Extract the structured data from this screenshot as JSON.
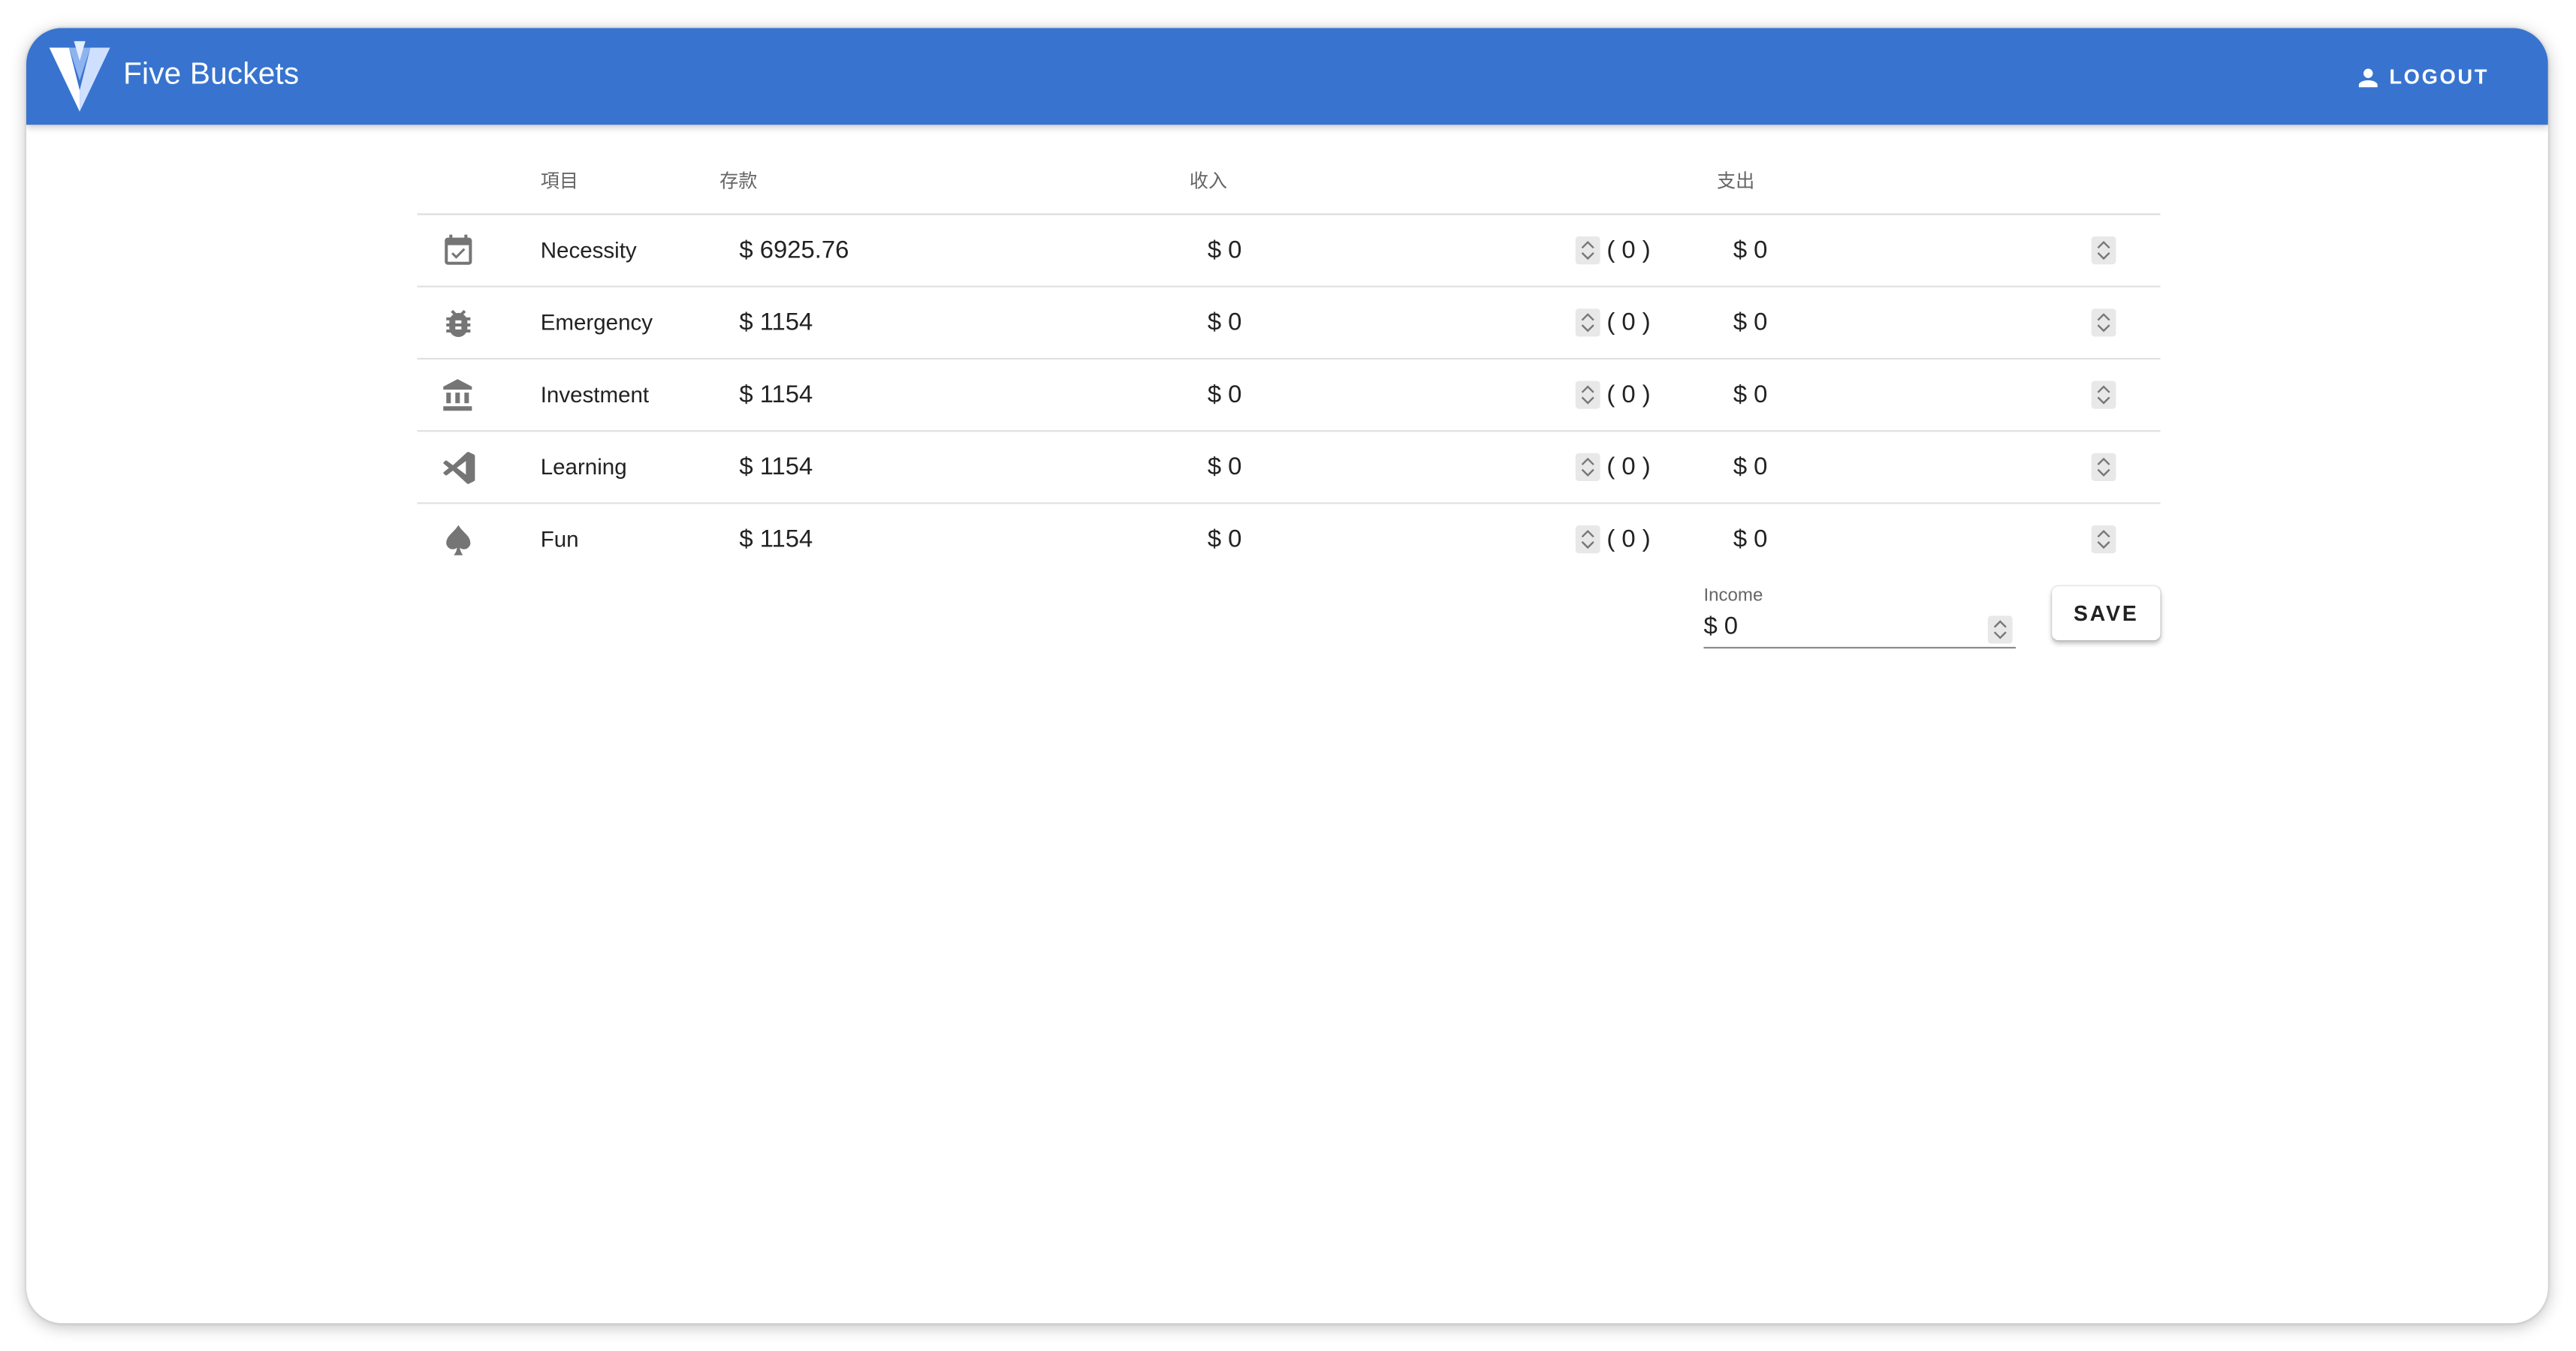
{
  "app": {
    "title": "Five Buckets",
    "logout_label": "LOGOUT",
    "brand_color": "#3874CF"
  },
  "table": {
    "headers": {
      "item": "項目",
      "savings": "存款",
      "income": "收入",
      "expense": "支出"
    },
    "rows": [
      {
        "icon": "calendar-check-icon",
        "name": "Necessity",
        "savings": "$ 6925.76",
        "income": "$ 0",
        "income_paren": "( 0 )",
        "expense": "$ 0"
      },
      {
        "icon": "bug-icon",
        "name": "Emergency",
        "savings": "$ 1154",
        "income": "$ 0",
        "income_paren": "( 0 )",
        "expense": "$ 0"
      },
      {
        "icon": "bank-icon",
        "name": "Investment",
        "savings": "$ 1154",
        "income": "$ 0",
        "income_paren": "( 0 )",
        "expense": "$ 0"
      },
      {
        "icon": "code-editor-icon",
        "name": "Learning",
        "savings": "$ 1154",
        "income": "$ 0",
        "income_paren": "( 0 )",
        "expense": "$ 0"
      },
      {
        "icon": "spade-icon",
        "name": "Fun",
        "savings": "$ 1154",
        "income": "$ 0",
        "income_paren": "( 0 )",
        "expense": "$ 0"
      }
    ]
  },
  "footer": {
    "income_label": "Income",
    "income_value": "$ 0",
    "save_label": "SAVE"
  }
}
